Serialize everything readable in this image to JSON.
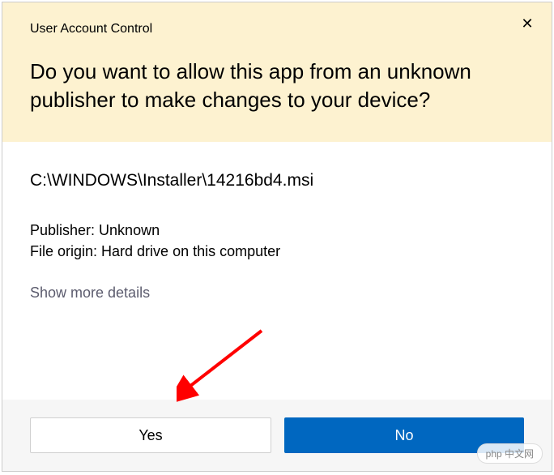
{
  "dialog": {
    "title": "User Account Control",
    "question": "Do you want to allow this app from an unknown publisher to make changes to your device?",
    "file_path": "C:\\WINDOWS\\Installer\\14216bd4.msi",
    "publisher_line": "Publisher: Unknown",
    "origin_line": "File origin: Hard drive on this computer",
    "show_more_label": "Show more details",
    "yes_label": "Yes",
    "no_label": "No"
  },
  "watermark": {
    "text": "php 中文网"
  }
}
